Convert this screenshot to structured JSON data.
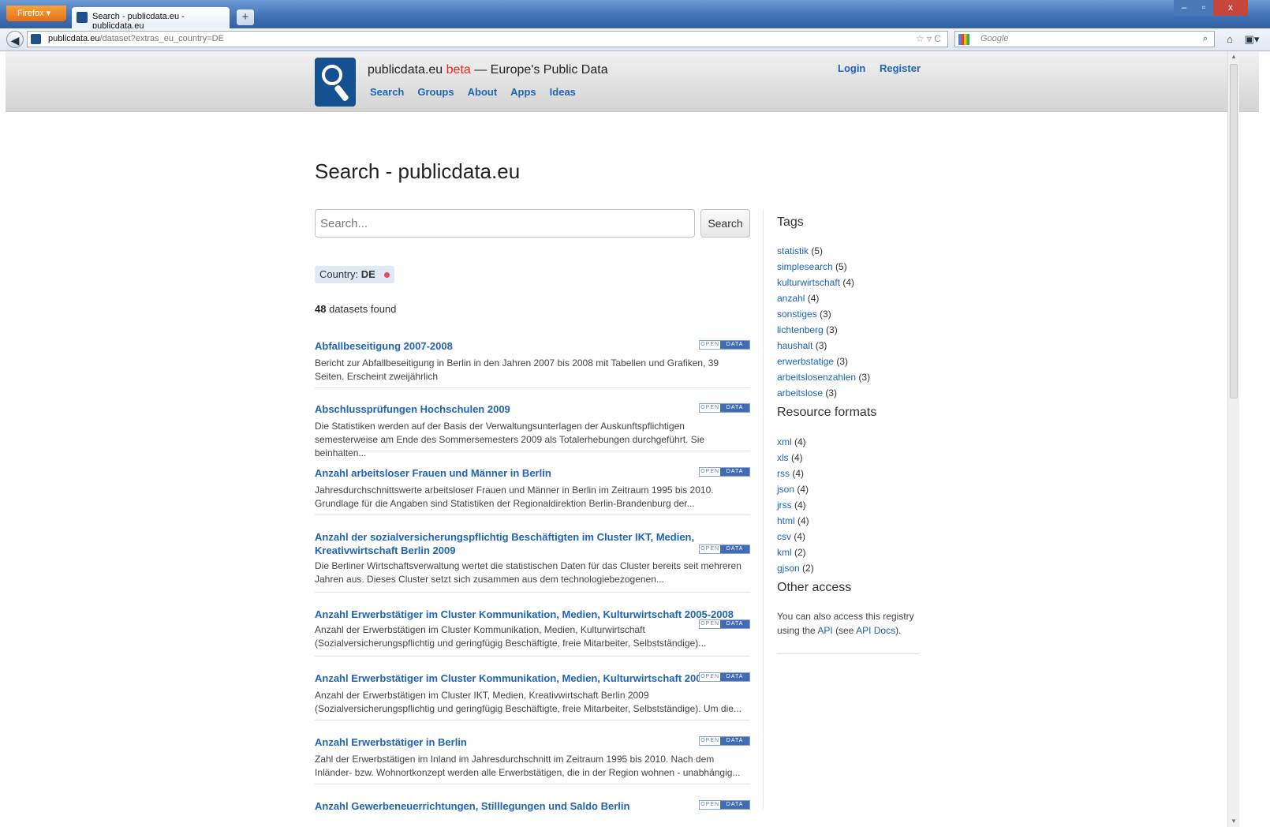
{
  "browser": {
    "menu_label": "Firefox",
    "tab_title": "Search - publicdata.eu - publicdata.eu",
    "new_tab": "+",
    "url_host": "publicdata.eu",
    "url_path": "/dataset?extras_eu_country=DE",
    "search_placeholder": "Google",
    "window_controls": [
      "–",
      "▫",
      "x"
    ]
  },
  "site": {
    "name": "publicdata.eu",
    "beta": "beta",
    "tagline": "— Europe's Public Data",
    "nav": [
      "Search",
      "Groups",
      "About",
      "Apps",
      "Ideas"
    ],
    "login": "Login",
    "register": "Register"
  },
  "page_title": "Search - publicdata.eu",
  "search": {
    "placeholder": "Search...",
    "button": "Search"
  },
  "facet": {
    "label": "Country:",
    "value": "DE"
  },
  "results_count": {
    "number": "48",
    "text": "datasets found"
  },
  "badge": {
    "open": "OPEN",
    "data": "DATA"
  },
  "results": [
    {
      "title": "Abfallbeseitigung 2007-2008",
      "desc": "Bericht zur Abfallbeseitigung in Berlin in den Jahren 2007 bis 2008 mit Tabellen und Grafiken, 39 Seiten. Erscheint zweijährlich"
    },
    {
      "title": "Abschlussprüfungen Hochschulen 2009",
      "desc": "Die Statistiken werden auf der Basis der Verwaltungsunterlagen der Auskunftspflichtigen semesterweise am Ende des Sommersemesters 2009 als Totalerhebungen durchgeführt. Sie beinhalten..."
    },
    {
      "title": "Anzahl arbeitsloser Frauen und Männer in Berlin",
      "desc": "Jahresdurchschnittswerte arbeitsloser Frauen und Männer in Berlin im Zeitraum 1995 bis 2010. Grundlage für die Angaben sind Statistiken der Regionaldirektion Berlin-Brandenburg der..."
    },
    {
      "title": "Anzahl der sozialversicherungspflichtig Beschäftigten im Cluster IKT, Medien, Kreativwirtschaft Berlin 2009",
      "desc": "Die Berliner Wirtschaftsverwaltung wertet die statistischen Daten für das Cluster bereits seit mehreren Jahren aus. Dieses Cluster setzt sich zusammen aus dem technologiebezogenen..."
    },
    {
      "title": "Anzahl Erwerbstätiger im Cluster Kommunikation, Medien, Kulturwirtschaft 2005-2008",
      "desc": "Anzahl der Erwerbstätigen im Cluster Kommunikation, Medien, Kulturwirtschaft (Sozialversicherungspflichtig und geringfügig Beschäftigte, freie Mitarbeiter, Selbstständige)..."
    },
    {
      "title": "Anzahl Erwerbstätiger im Cluster Kommunikation, Medien, Kulturwirtschaft 2009",
      "desc": "Anzahl der Erwerbstätigen im Cluster IKT, Medien, Kreativwirtschaft Berlin 2009 (Sozialversicherungspflichtig und geringfügig Beschäftigte, freie Mitarbeiter, Selbstständige). Um die..."
    },
    {
      "title": "Anzahl Erwerbstätiger in Berlin",
      "desc": "Zahl der Erwerbstätigen im Inland im Jahresdurchschnitt im Zeitraum 1995 bis 2010. Nach dem Inländer- bzw. Wohnortkonzept werden alle Erwerbstätigen, die in der Region wohnen - unabhängig..."
    },
    {
      "title": "Anzahl Gewerbeneuerrichtungen, Stilllegungen und Saldo Berlin",
      "desc": ""
    }
  ],
  "sidebar": {
    "tags_title": "Tags",
    "tags": [
      {
        "name": "statistik",
        "count": "(5)"
      },
      {
        "name": "simplesearch",
        "count": "(5)"
      },
      {
        "name": "kulturwirtschaft",
        "count": "(4)"
      },
      {
        "name": "anzahl",
        "count": "(4)"
      },
      {
        "name": "sonstiges",
        "count": "(3)"
      },
      {
        "name": "lichtenberg",
        "count": "(3)"
      },
      {
        "name": "haushalt",
        "count": "(3)"
      },
      {
        "name": "erwerbstatige",
        "count": "(3)"
      },
      {
        "name": "arbeitslosenzahlen",
        "count": "(3)"
      },
      {
        "name": "arbeitslose",
        "count": "(3)"
      }
    ],
    "formats_title": "Resource formats",
    "formats": [
      {
        "name": "xml",
        "count": "(4)"
      },
      {
        "name": "xls",
        "count": "(4)"
      },
      {
        "name": "rss",
        "count": "(4)"
      },
      {
        "name": "json",
        "count": "(4)"
      },
      {
        "name": "jrss",
        "count": "(4)"
      },
      {
        "name": "html",
        "count": "(4)"
      },
      {
        "name": "csv",
        "count": "(4)"
      },
      {
        "name": "kml",
        "count": "(2)"
      },
      {
        "name": "gjson",
        "count": "(2)"
      }
    ],
    "other_title": "Other access",
    "other_text_1": "You can also access this registry using the",
    "api_link": "API",
    "other_text_2": "(see",
    "api_docs_link": "API Docs",
    "other_text_3": ")."
  }
}
